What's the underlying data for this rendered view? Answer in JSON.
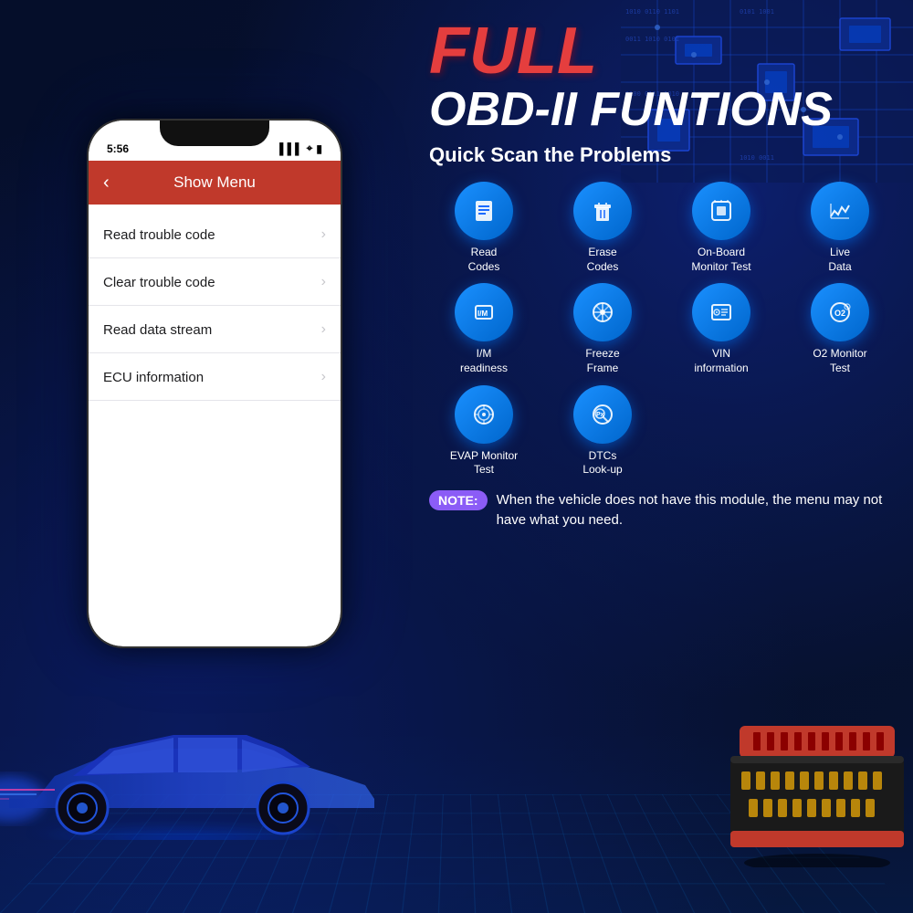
{
  "background": {
    "color": "#050e2a"
  },
  "phone": {
    "status_time": "5:56",
    "header_title": "Show Menu",
    "back_arrow": "‹",
    "menu_items": [
      {
        "label": "Read trouble code",
        "chevron": "›"
      },
      {
        "label": "Clear trouble code",
        "chevron": "›"
      },
      {
        "label": "Read data stream",
        "chevron": "›"
      },
      {
        "label": "ECU information",
        "chevron": "›"
      }
    ]
  },
  "hero": {
    "full_label": "FULL",
    "obd_label": "OBD-II FUNTIONS",
    "subtitle": "Quick Scan the Problems"
  },
  "functions": [
    {
      "icon": "📄",
      "label": "Read\nCodes",
      "unicode": "doc"
    },
    {
      "icon": "🗑",
      "label": "Erase\nCodes",
      "unicode": "trash"
    },
    {
      "icon": "💻",
      "label": "On-Board\nMonitor Test",
      "unicode": "chip"
    },
    {
      "icon": "📈",
      "label": "Live\nData",
      "unicode": "chart"
    },
    {
      "icon": "IM",
      "label": "I/M\nreadiness",
      "unicode": "im"
    },
    {
      "icon": "❄",
      "label": "Freeze\nFrame",
      "unicode": "snowflake"
    },
    {
      "icon": "🚗",
      "label": "VIN\ninformation",
      "unicode": "vin"
    },
    {
      "icon": "O2",
      "label": "O2 Monitor\nTest",
      "unicode": "o2"
    },
    {
      "icon": "◎",
      "label": "EVAP Monitor\nTest",
      "unicode": "evap"
    },
    {
      "icon": "Px",
      "label": "DTCs\nLook-up",
      "unicode": "dtc"
    }
  ],
  "note": {
    "badge": "NOTE:",
    "text": "When the vehicle does not have this module, the menu may not have what you need."
  }
}
